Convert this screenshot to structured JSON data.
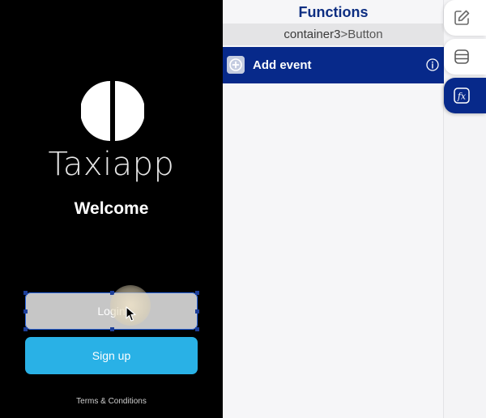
{
  "preview": {
    "brand": "Taxiapp",
    "welcome": "Welcome",
    "login_label": "Login",
    "signup_label": "Sign up",
    "terms": "Terms & Conditions"
  },
  "panel": {
    "title": "Functions",
    "breadcrumb_container": "container3",
    "breadcrumb_separator": ">",
    "breadcrumb_element": "Button",
    "add_event_label": "Add event"
  },
  "colors": {
    "panel_accent": "#07298a",
    "signup_button": "#29b1e6",
    "login_button": "#c6c6c6",
    "selection_outline": "#2a66e0"
  },
  "icons": {
    "logo": "taxiapp-logo",
    "add": "plus-icon",
    "info": "info-icon",
    "tabs": [
      "edit-icon",
      "database-icon",
      "function-icon"
    ]
  }
}
